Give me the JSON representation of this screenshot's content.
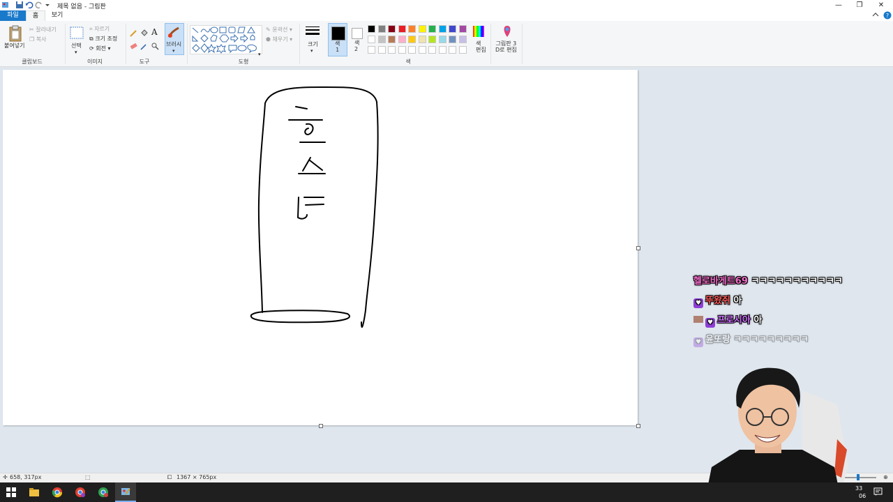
{
  "window": {
    "title": "제목 없음 - 그림판",
    "controls": [
      "minimize",
      "maximize",
      "close"
    ]
  },
  "tabs": [
    {
      "label": "파일",
      "active": false
    },
    {
      "label": "홈",
      "active": true
    },
    {
      "label": "보기",
      "active": false
    }
  ],
  "ribbon": {
    "clipboard": {
      "paste": "붙여넣기",
      "cut": "잘라내기",
      "copy": "복사",
      "group": "클립보드"
    },
    "image": {
      "select": "선택",
      "crop": "자르기",
      "resize": "크기 조정",
      "rotate": "회전",
      "group": "이미지"
    },
    "tools": {
      "group": "도구"
    },
    "brushes": {
      "label": "브러시"
    },
    "shapes": {
      "outline": "윤곽선",
      "fill": "채우기",
      "group": "도형"
    },
    "size": {
      "label": "크기"
    },
    "color1": {
      "label": "색\n1"
    },
    "color2": {
      "label": "색\n2"
    },
    "colors": {
      "group": "색",
      "edit": "색\n편집"
    },
    "paint3d": {
      "label": "그림판 3\nD로 편집"
    },
    "palette": [
      "#000000",
      "#7f7f7f",
      "#880015",
      "#ed1c24",
      "#ff7f27",
      "#fff200",
      "#22b14c",
      "#00a2e8",
      "#3f48cc",
      "#a349a4",
      "#ffffff",
      "#c3c3c3",
      "#b97a57",
      "#ffaec9",
      "#ffc90e",
      "#efe4b0",
      "#b5e61d",
      "#99d9ea",
      "#7092be",
      "#c8bfe7"
    ]
  },
  "chat": [
    {
      "user": "헬로바게트69",
      "message": "ㅋㅋㅋㅋㅋㅋㅋㅋㅋㅋㅋ",
      "user_color": "#f06bc8",
      "badges": []
    },
    {
      "user": "뚜왔쥐",
      "message": "아",
      "user_color": "#ff5a5a",
      "badges": [
        "heart"
      ]
    },
    {
      "user": "프로시아",
      "message": "아",
      "user_color": "#d070ff",
      "badges": [
        "flag",
        "heart"
      ]
    },
    {
      "user": "윤또랑",
      "message": "ㅋㅋㅋㅋㅋㅋㅋㅋㅋ",
      "user_color": "#ffffff",
      "badges": [
        "heart"
      ],
      "faded": true
    }
  ],
  "status": {
    "cursor_pos": "658, 317px",
    "canvas_size": "1367 × 765px"
  },
  "taskbar": {
    "clock_top": "33",
    "clock_bottom": "06"
  }
}
